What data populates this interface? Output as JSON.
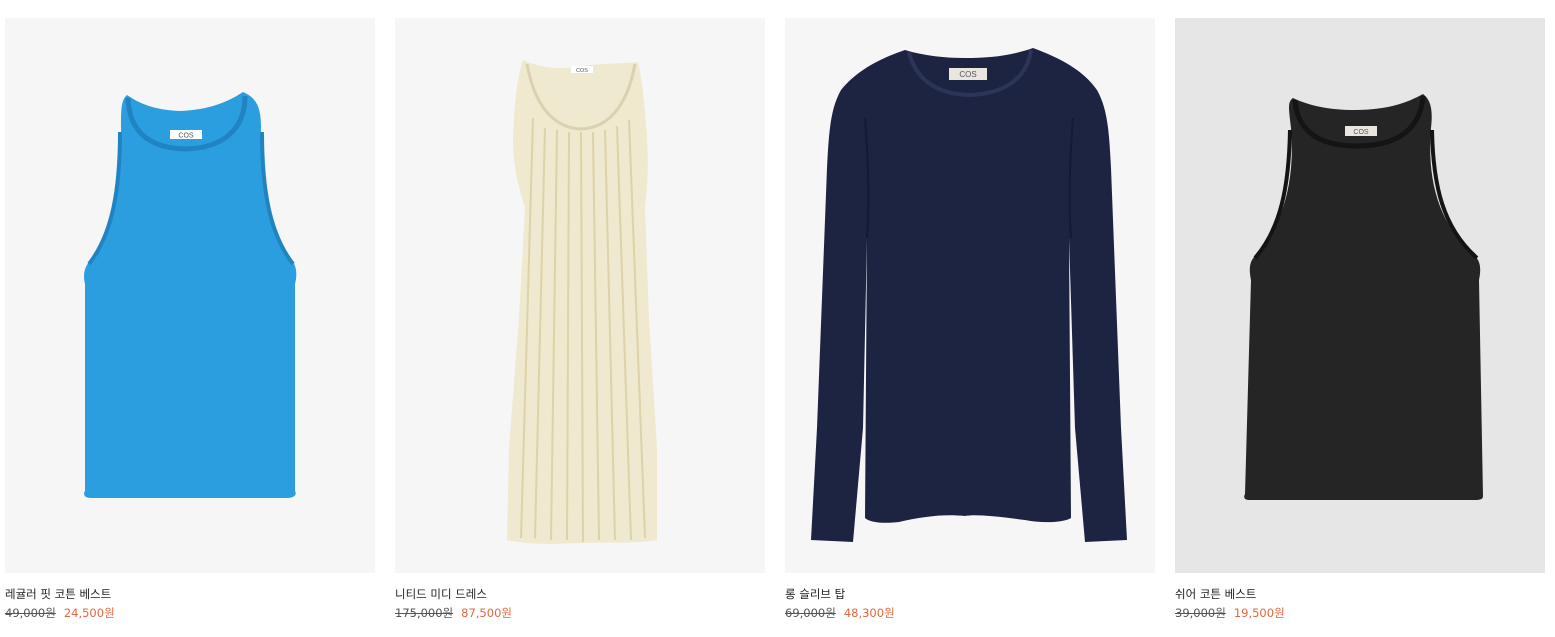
{
  "products": [
    {
      "name": "레귤러 핏 코튼 베스트",
      "original_price": "49,000원",
      "sale_price": "24,500원",
      "label": "COS",
      "image": "blue-tank-top",
      "garment_color": "#2b9ee0",
      "background_color": "#f6f6f6"
    },
    {
      "name": "니티드 미디 드레스",
      "original_price": "175,000원",
      "sale_price": "87,500원",
      "label": "COS",
      "image": "cream-knit-midi-dress",
      "garment_color": "#efe9cf",
      "background_color": "#f6f6f6"
    },
    {
      "name": "롱 슬리브 탑",
      "original_price": "69,000원",
      "sale_price": "48,300원",
      "label": "COS",
      "image": "navy-long-sleeve-top",
      "garment_color": "#1c2442",
      "background_color": "#f6f6f6"
    },
    {
      "name": "쉬어 코튼 베스트",
      "original_price": "39,000원",
      "sale_price": "19,500원",
      "label": "COS",
      "image": "black-sheer-tank-top",
      "garment_color": "#252525",
      "background_color": "#e6e6e6"
    }
  ]
}
